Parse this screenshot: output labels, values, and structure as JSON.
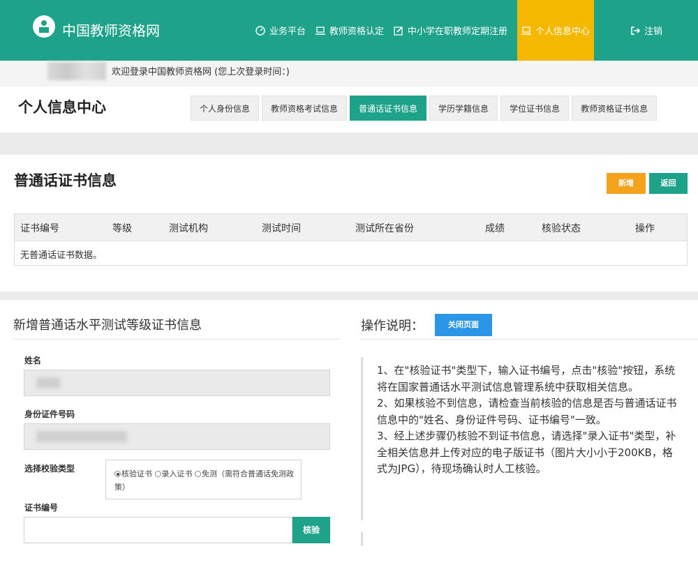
{
  "header": {
    "site_title": "中国教师资格网",
    "nav": [
      {
        "label": "业务平台",
        "icon": "dashboard-icon"
      },
      {
        "label": "教师资格认定",
        "icon": "laptop-icon"
      },
      {
        "label": "中小学在职教师定期注册",
        "icon": "edit-icon"
      },
      {
        "label": "个人信息中心",
        "icon": "laptop-icon",
        "active": true
      }
    ],
    "logout": "注销",
    "colors": {
      "primary": "#1fa28a",
      "active_nav": "#f5b800"
    }
  },
  "welcome": "欢迎登录中国教师资格网 (您上次登录时间：)",
  "page_title": "个人信息中心",
  "tabs": [
    {
      "label": "个人身份信息"
    },
    {
      "label": "教师资格考试信息"
    },
    {
      "label": "普通话证书信息",
      "active": true
    },
    {
      "label": "学历学籍信息"
    },
    {
      "label": "学位证书信息"
    },
    {
      "label": "教师资格证书信息"
    }
  ],
  "cert_section": {
    "title": "普通话证书信息",
    "add_label": "新增",
    "back_label": "返回",
    "columns": [
      "证书编号",
      "等级",
      "测试机构",
      "测试时间",
      "测试所在省份",
      "成绩",
      "核验状态",
      "操作"
    ],
    "empty_text": "无普通话证书数据。"
  },
  "form": {
    "title": "新增普通话水平测试等级证书信息",
    "name_label": "姓名",
    "id_label": "身份证件号码",
    "verify_type_label": "选择校验类型",
    "options": [
      "核验证书",
      "录入证书",
      "免测（需符合普通话免测政策）"
    ],
    "selected_option": "核验证书",
    "cert_no_label": "证书编号",
    "verify_button": "核验"
  },
  "instructions": {
    "title": "操作说明：",
    "close_button": "关闭页面",
    "items": [
      "1、在\"核验证书\"类型下，输入证书编号，点击\"核验\"按钮，系统将在国家普通话水平测试信息管理系统中获取相关信息。",
      "2、如果核验不到信息，请检查当前核验的信息是否与普通话证书信息中的\"姓名、身份证件号码、证书编号\"一致。",
      "3、经上述步骤仍核验不到证书信息，请选择\"录入证书\"类型，补全相关信息并上传对应的电子版证书（图片大小小于200KB，格式为JPG），待现场确认时人工核验。"
    ]
  }
}
